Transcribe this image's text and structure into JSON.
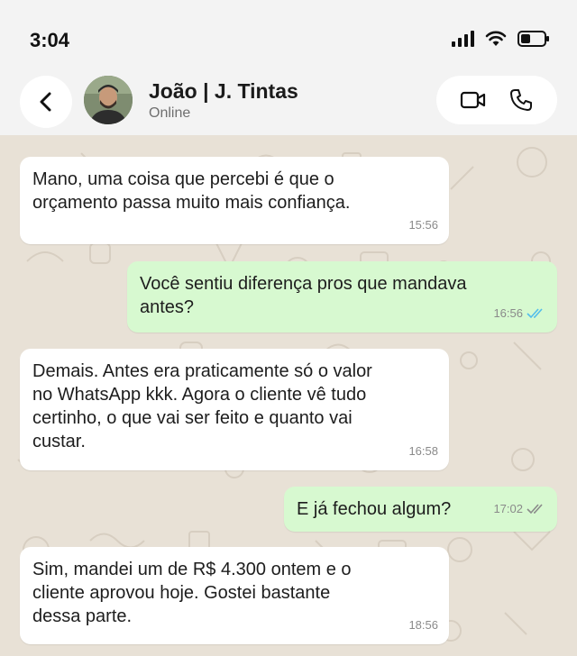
{
  "status_bar": {
    "time": "3:04"
  },
  "header": {
    "contact_name": "João | J. Tintas",
    "contact_status": "Online"
  },
  "colors": {
    "chat_bg": "#e8e1d6",
    "incoming_bubble": "#ffffff",
    "outgoing_bubble": "#d7f9d0",
    "read_ticks": "#53bdeb"
  },
  "messages": [
    {
      "direction": "in",
      "text": "Mano, uma coisa que percebi é que o\norçamento passa muito mais confiança.",
      "time": "15:56"
    },
    {
      "direction": "out",
      "text": "Você sentiu diferença pros que mandava\nantes?",
      "time": "16:56",
      "status": "read"
    },
    {
      "direction": "in",
      "text": "Demais. Antes era praticamente só o valor\nno WhatsApp kkk. Agora o cliente vê tudo\ncertinho, o que vai ser feito e quanto vai\ncustar.",
      "time": "16:58"
    },
    {
      "direction": "out",
      "text": "E já fechou algum?",
      "time": "17:02",
      "status": "delivered"
    },
    {
      "direction": "in",
      "text": "Sim, mandei um de R$ 4.300 ontem e o\ncliente aprovou hoje. Gostei bastante\ndessa parte.",
      "time": "18:56"
    }
  ]
}
